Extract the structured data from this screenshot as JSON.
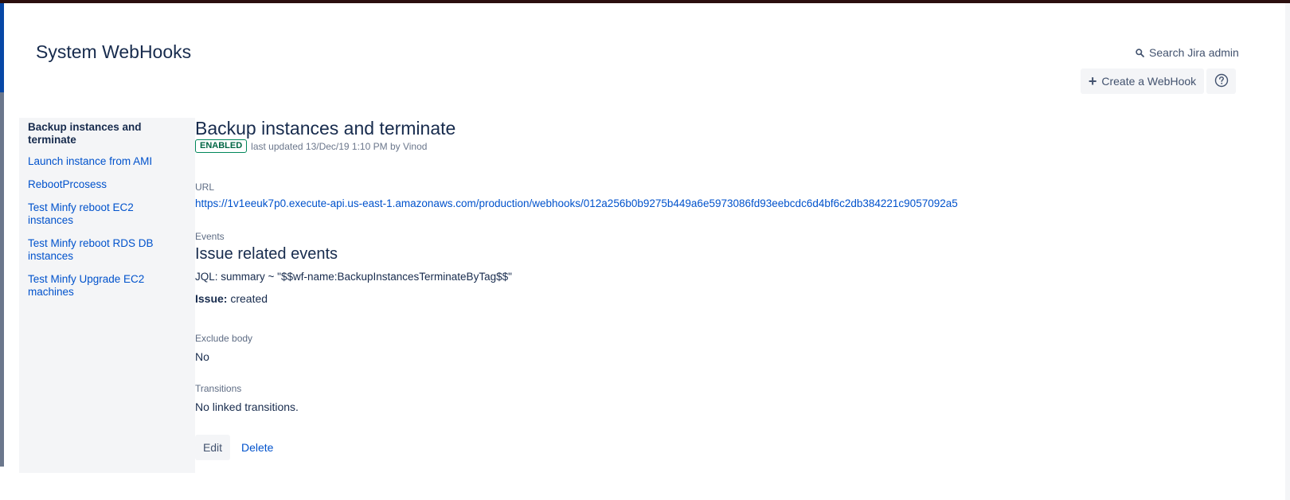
{
  "header": {
    "title": "System WebHooks",
    "search_label": "Search Jira admin",
    "create_label": "Create a WebHook",
    "help_icon": "question-circle-icon"
  },
  "sidebar": {
    "items": [
      {
        "label": "Backup instances and terminate",
        "active": true
      },
      {
        "label": "Launch instance from AMI",
        "active": false
      },
      {
        "label": "RebootPrcosess",
        "active": false
      },
      {
        "label": "Test Minfy reboot EC2 instances",
        "active": false
      },
      {
        "label": "Test Minfy reboot RDS DB instances",
        "active": false
      },
      {
        "label": "Test Minfy Upgrade EC2 machines",
        "active": false
      }
    ]
  },
  "webhook": {
    "name": "Backup instances and terminate",
    "status": "ENABLED",
    "last_updated": "last updated 13/Dec/19 1:10 PM by Vinod",
    "url_label": "URL",
    "url": "https://1v1eeuk7p0.execute-api.us-east-1.amazonaws.com/production/webhooks/012a256b0b9275b449a6e5973086fd93eebcdc6d4bf6c2db384221c9057092a5",
    "events_label": "Events",
    "events_heading": "Issue related events",
    "jql": "JQL: summary ~ \"$$wf-name:BackupInstancesTerminateByTag$$\"",
    "issue_label": "Issue:",
    "issue_value": "created",
    "exclude_body_label": "Exclude body",
    "exclude_body_value": "No",
    "transitions_label": "Transitions",
    "transitions_value": "No linked transitions."
  },
  "actions": {
    "edit_label": "Edit",
    "delete_label": "Delete"
  },
  "colors": {
    "link": "#0052cc",
    "text": "#172b4d",
    "sidebar_bg": "#f4f5f7",
    "status_green": "#00875a"
  }
}
